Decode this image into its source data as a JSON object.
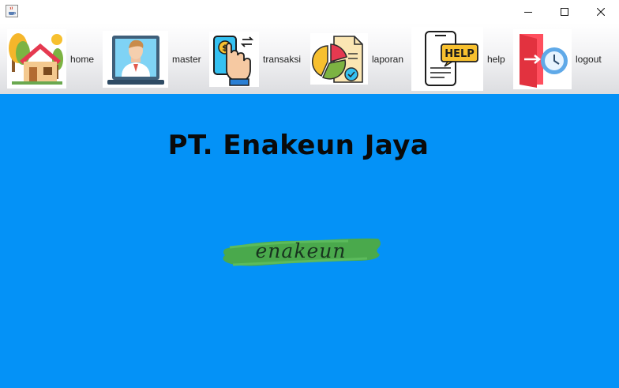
{
  "window": {
    "icon": "java-cup-icon",
    "controls": {
      "minimize": "minimize-icon",
      "maximize": "maximize-icon",
      "close": "close-icon"
    }
  },
  "toolbar": {
    "items": [
      {
        "label": "home",
        "icon": "house-icon"
      },
      {
        "label": "master",
        "icon": "person-laptop-icon"
      },
      {
        "label": "transaksi",
        "icon": "phone-payment-icon"
      },
      {
        "label": "laporan",
        "icon": "pie-chart-report-icon"
      },
      {
        "label": "help",
        "icon": "help-phone-icon"
      },
      {
        "label": "logout",
        "icon": "door-clock-icon"
      }
    ]
  },
  "main": {
    "company_name": "PT. Enakeun Jaya",
    "logo_text": "enakeun"
  },
  "colors": {
    "background": "#0492f7",
    "logo_brush": "#4aa94c",
    "title_text": "#0a0a0a"
  }
}
